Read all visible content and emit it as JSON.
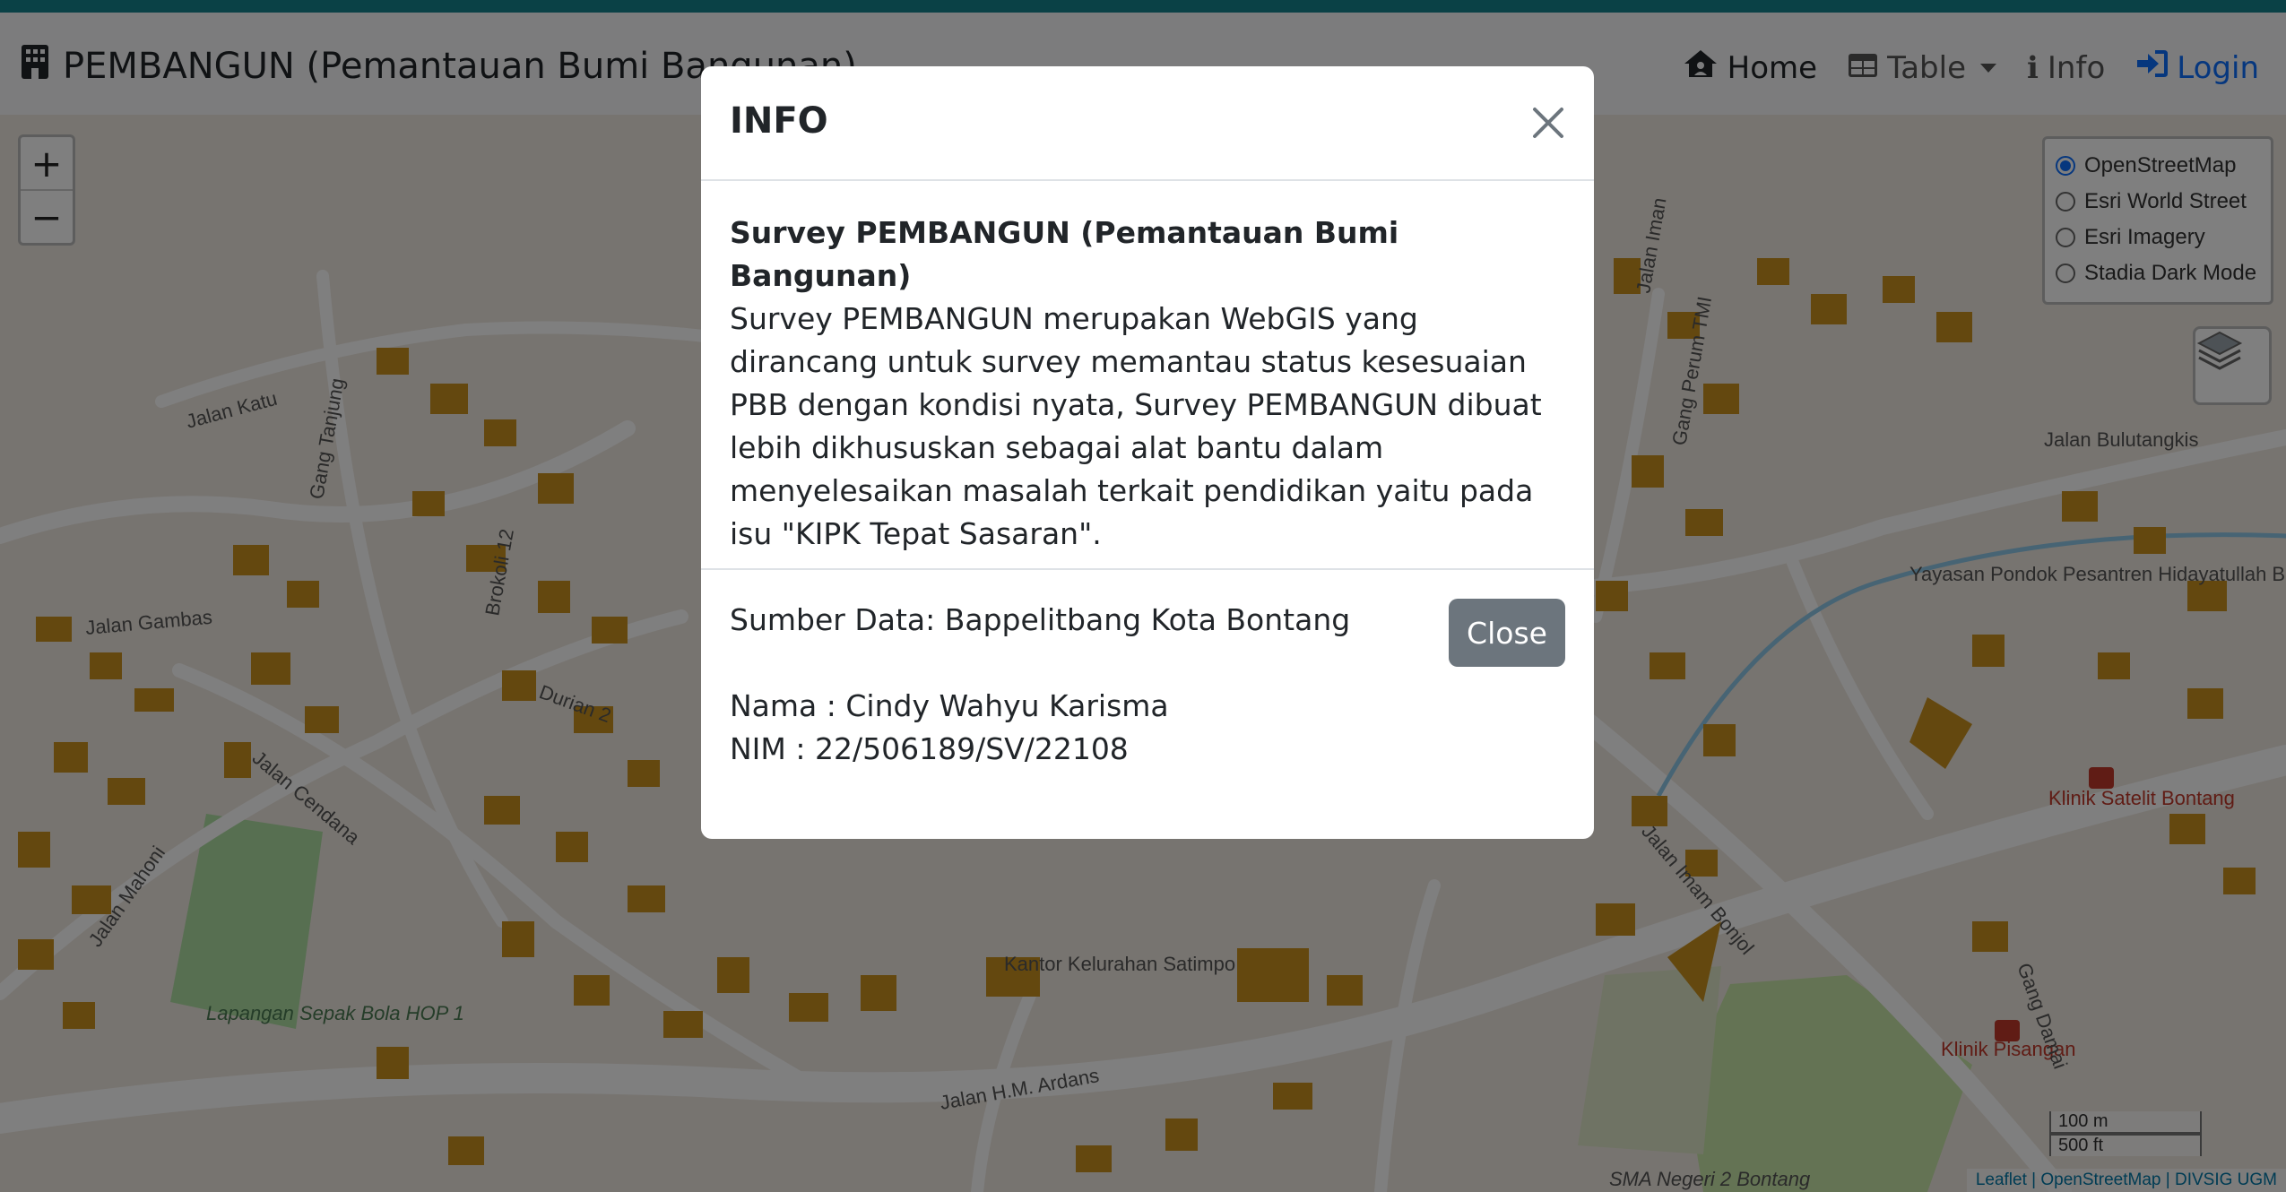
{
  "navbar": {
    "brand": "PEMBANGUN (Pemantauan Bumi Bangunan)",
    "home": "Home",
    "table": "Table",
    "info": "Info",
    "login": "Login"
  },
  "map": {
    "zoom_in": "+",
    "zoom_out": "−",
    "layers": [
      "OpenStreetMap",
      "Esri World Street",
      "Esri Imagery",
      "Stadia Dark Mode"
    ],
    "selected_layer": "OpenStreetMap",
    "scale": {
      "metric": "100 m",
      "imperial": "500 ft"
    },
    "attribution": "Leaflet | OpenStreetMap | DIVSIG UGM",
    "labels": {
      "jalan_katu": "Jalan Katu",
      "gang_tanjung": "Gang Tanjung",
      "jalan_gambas": "Jalan Gambas",
      "brokoli": "Brokoli 12",
      "durian2": "Durian 2",
      "jalan_cendana": "Jalan Cendana",
      "jalan_mahoni": "Jalan Mahoni",
      "lapangan": "Lapangan Sepak Bola HOP 1",
      "jalan_ardans": "Jalan H.M. Ardans",
      "kantor": "Kantor Kelurahan Satimpo",
      "sma": "SMA Negeri 2 Bontang",
      "imam_bonjol": "Jalan Imam Bonjol",
      "bulutangkis": "Jalan Bulutangkis",
      "yayasan": "Yayasan Pondok Pesantren Hidayatullah Bontang",
      "klinik_satelit": "Klinik Satelit Bontang",
      "klinik_pisangan": "Klinik Pisangan",
      "gang_damai": "Gang Damai",
      "gang_perum": "Gang Perum TMI",
      "jalan_iman": "Jalan Iman"
    }
  },
  "modal": {
    "title": "INFO",
    "heading": "Survey PEMBANGUN (Pemantauan Bumi Bangunan)",
    "paragraph": "Survey PEMBANGUN merupakan WebGIS yang dirancang untuk survey memantau status kesesuaian PBB dengan kondisi nyata, Survey PEMBANGUN dibuat lebih dikhususkan sebagai alat bantu dalam menyelesaikan masalah terkait pendidikan yaitu pada isu \"KIPK Tepat Sasaran\".",
    "source": "Sumber Data: Bappelitbang Kota Bontang",
    "name": "Nama : Cindy Wahyu Karisma",
    "nim": "NIM : 22/506189/SV/22108",
    "close_label": "Close"
  }
}
